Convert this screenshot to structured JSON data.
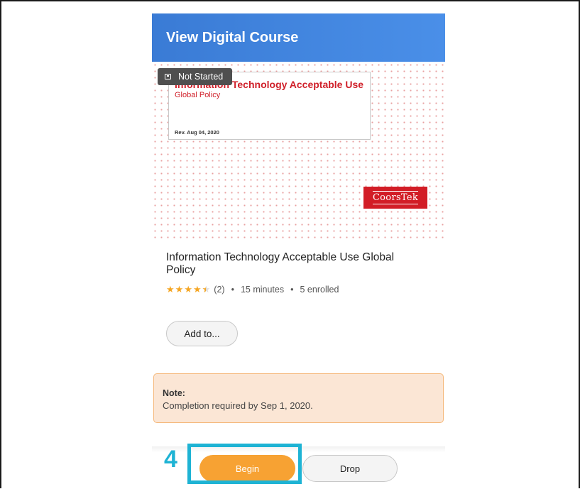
{
  "header": {
    "title": "View Digital Course"
  },
  "thumbnail": {
    "status_badge": "Not Started",
    "card_title": "Information Technology Acceptable Use",
    "card_subtitle": "Global Policy",
    "card_revision": "Rev. Aug 04, 2020",
    "logo_text": "CoorsTek"
  },
  "course": {
    "title": "Information Technology Acceptable Use Global Policy",
    "rating": 4.5,
    "rating_count": "(2)",
    "duration": "15 minutes",
    "enrolled": "5 enrolled",
    "separator": "•"
  },
  "actions": {
    "add_to_label": "Add to...",
    "begin_label": "Begin",
    "drop_label": "Drop"
  },
  "note": {
    "title": "Note:",
    "text": "Completion required by Sep 1, 2020."
  },
  "annotation": {
    "step_number": "4"
  },
  "colors": {
    "header": "#3a7bd5",
    "begin": "#f7a233",
    "brand_red": "#d21d26",
    "highlight": "#1eb3d4",
    "note_bg": "#fbe6d5",
    "note_border": "#f5b87a"
  }
}
